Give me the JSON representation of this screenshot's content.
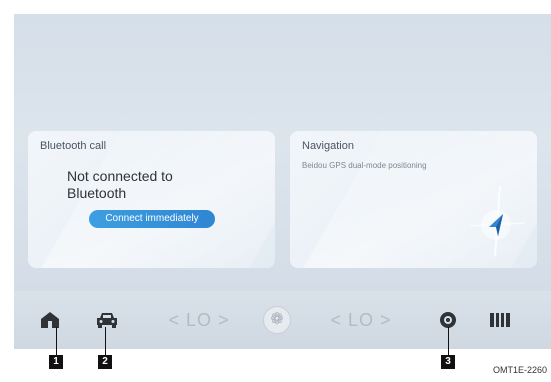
{
  "bluetooth_card": {
    "title": "Bluetooth call",
    "status": "Not connected to Bluetooth",
    "button": "Connect immediately"
  },
  "navigation_card": {
    "title": "Navigation",
    "subtitle": "Beidou GPS dual-mode positioning"
  },
  "dock": {
    "left_temp": "< LO >",
    "right_temp": "< LO >",
    "icons": [
      "home-icon",
      "car-icon",
      "fan-icon",
      "camera-icon",
      "apps-icon"
    ]
  },
  "callouts": [
    "1",
    "2",
    "3"
  ],
  "figure_ref": "OMT1E-2260",
  "colors": {
    "accent": "#3d9fe0",
    "screen": "#d5dfe9"
  }
}
